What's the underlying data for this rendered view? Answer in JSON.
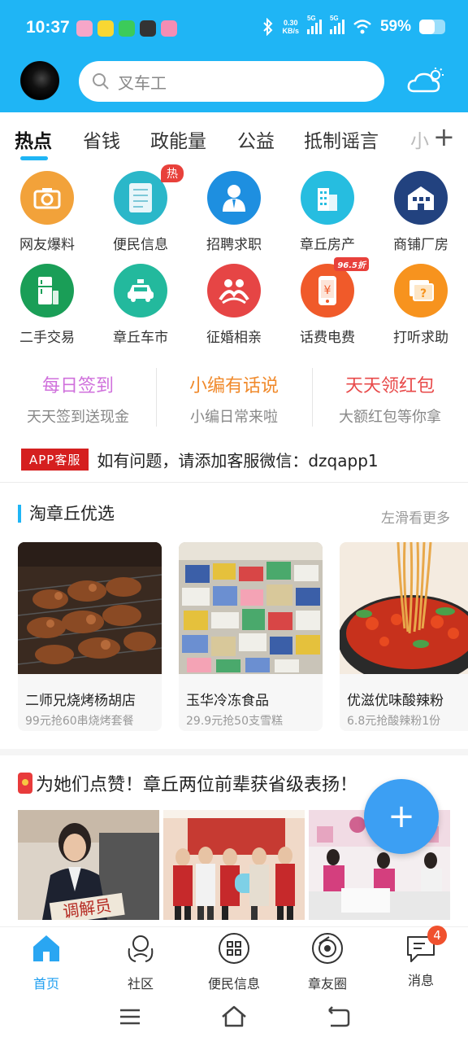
{
  "status_bar": {
    "time": "10:37",
    "net_speed": "0.30",
    "net_unit": "KB/s",
    "sim1": "5G",
    "sim2": "5G",
    "battery": "59%",
    "battery_level": 0.59
  },
  "header": {
    "search_placeholder": "叉车工"
  },
  "tabs": [
    {
      "label": "热点",
      "active": true
    },
    {
      "label": "省钱"
    },
    {
      "label": "政能量"
    },
    {
      "label": "公益"
    },
    {
      "label": "抵制谣言"
    },
    {
      "label": "小"
    }
  ],
  "grid": [
    {
      "label": "网友爆料",
      "color": "#f2a23a",
      "icon": "camera-icon"
    },
    {
      "label": "便民信息",
      "color": "#2bb7c9",
      "icon": "document-icon",
      "badge": "热"
    },
    {
      "label": "招聘求职",
      "color": "#1e8fe0",
      "icon": "person-icon"
    },
    {
      "label": "章丘房产",
      "color": "#26bde0",
      "icon": "building-icon"
    },
    {
      "label": "商铺厂房",
      "color": "#22427f",
      "icon": "shop-icon"
    },
    {
      "label": "二手交易",
      "color": "#1a9e57",
      "icon": "fridge-icon"
    },
    {
      "label": "章丘车市",
      "color": "#23b99d",
      "icon": "car-icon"
    },
    {
      "label": "征婚相亲",
      "color": "#e64545",
      "icon": "couple-icon"
    },
    {
      "label": "话费电费",
      "color": "#f05a2a",
      "icon": "phone-bill-icon",
      "badge": "96.5折"
    },
    {
      "label": "打听求助",
      "color": "#f7931e",
      "icon": "question-icon"
    }
  ],
  "promos": [
    {
      "title": "每日签到",
      "sub": "天天签到送现金",
      "color": "#d071dc"
    },
    {
      "title": "小编有话说",
      "sub": "小编日常来啦",
      "color": "#f08a2c"
    },
    {
      "title": "天天领红包",
      "sub": "大额红包等你拿",
      "color": "#e84a4a"
    }
  ],
  "notice": {
    "tag": "APP客服",
    "text": "如有问题，请添加客服微信：dzqapp1"
  },
  "selection": {
    "title": "淘章丘优选",
    "more": "左滑看更多",
    "cards": [
      {
        "name": "二师兄烧烤杨胡店",
        "desc": "99元抢60串烧烤套餐"
      },
      {
        "name": "玉华冷冻食品",
        "desc": "29.9元抢50支雪糕"
      },
      {
        "name": "优滋优味酸辣粉",
        "desc": "6.8元抢酸辣粉1份"
      }
    ]
  },
  "news": {
    "title": "为她们点赞！章丘两位前辈获省级表扬！",
    "img_text": "调解员"
  },
  "fab": "+",
  "bottom_nav": [
    {
      "label": "首页",
      "icon": "home-icon",
      "active": true
    },
    {
      "label": "社区",
      "icon": "community-icon"
    },
    {
      "label": "便民信息",
      "icon": "grid-icon"
    },
    {
      "label": "章友圈",
      "icon": "circle-icon"
    },
    {
      "label": "消息",
      "icon": "chat-icon",
      "badge": "4"
    }
  ]
}
